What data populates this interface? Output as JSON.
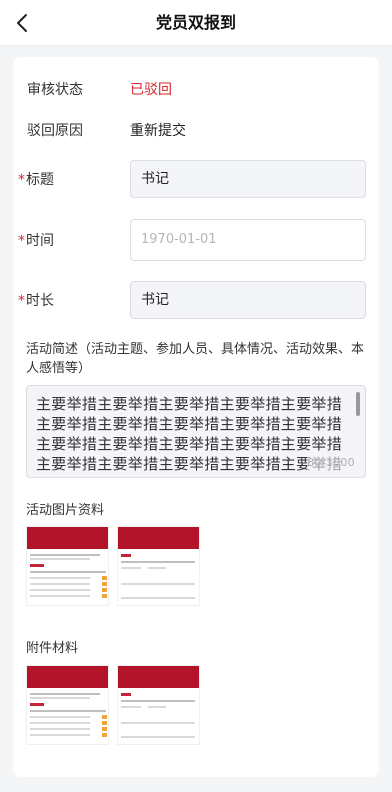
{
  "nav": {
    "title": "党员双报到",
    "back_icon": "chevron-left-icon"
  },
  "review": {
    "status_label": "审核状态",
    "status_value": "已驳回",
    "reason_label": "驳回原因",
    "reason_value": "重新提交"
  },
  "form": {
    "required_mark": "*",
    "title_label": "标题",
    "title_value": "书记",
    "time_label": "时间",
    "time_placeholder": "1970-01-01",
    "duration_label": "时长",
    "duration_value": "书记",
    "desc_label": "活动简述（活动主题、参加人员、具体情况、活动效果、本人感悟等）",
    "desc_value": "主要举措主要举措主要举措主要举措主要举措主要举措主要举措主要举措主要举措主要举措主要举措主要举措主要举措主要举措主要举措主要举措主要举措主要举措主要举措主要举措",
    "desc_counter": "80/1000"
  },
  "images_section": {
    "title": "活动图片资料"
  },
  "attachments_section": {
    "title": "附件材料"
  },
  "colors": {
    "accent_red": "#d6262e",
    "header_red": "#b3142a"
  }
}
